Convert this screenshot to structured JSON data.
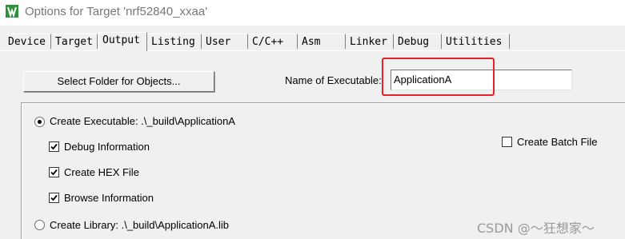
{
  "window": {
    "title": "Options for Target 'nrf52840_xxaa'"
  },
  "tabs": [
    {
      "label": "Device"
    },
    {
      "label": "Target"
    },
    {
      "label": "Output",
      "active": true
    },
    {
      "label": "Listing"
    },
    {
      "label": "User"
    },
    {
      "label": "C/C++"
    },
    {
      "label": "Asm"
    },
    {
      "label": "Linker"
    },
    {
      "label": "Debug"
    },
    {
      "label": "Utilities"
    }
  ],
  "output": {
    "select_folder_label": "Select Folder for Objects...",
    "name_of_executable_label": "Name of Executable:",
    "name_of_executable_value": "ApplicationA",
    "create_executable_label": "Create Executable:  .\\_build\\ApplicationA",
    "create_executable_selected": true,
    "debug_information_label": "Debug Information",
    "debug_information_checked": true,
    "create_hex_label": "Create HEX File",
    "create_hex_checked": true,
    "browse_information_label": "Browse Information",
    "browse_information_checked": true,
    "create_batch_label": "Create Batch File",
    "create_batch_checked": false,
    "create_library_label": "Create Library:  .\\_build\\ApplicationA.lib",
    "create_library_selected": false
  },
  "watermark": "CSDN @～狂想家～",
  "colors": {
    "highlight": "#e8202a",
    "icon": "#2f8f3a"
  }
}
